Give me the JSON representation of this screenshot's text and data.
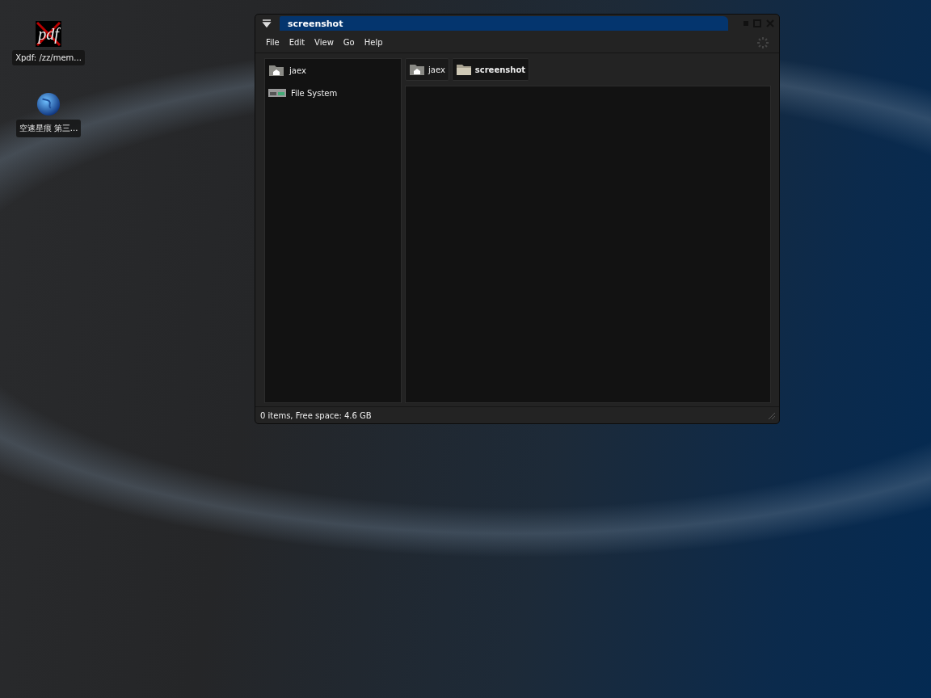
{
  "desktop_icons": [
    {
      "kind": "pdf",
      "icon_text": "pdf",
      "label": "Xpdf: /zz/mem..."
    },
    {
      "kind": "globe",
      "label": "空速星痕 第三..."
    }
  ],
  "window": {
    "title": "screenshot",
    "menu": [
      "File",
      "Edit",
      "View",
      "Go",
      "Help"
    ],
    "sidebar": {
      "items": [
        {
          "kind": "home",
          "label": "jaex",
          "selected": false
        },
        {
          "kind": "drive",
          "label": "File System",
          "selected": false
        }
      ]
    },
    "path_bar": [
      {
        "kind": "home",
        "label": "jaex",
        "selected": false
      },
      {
        "kind": "folder",
        "label": "screenshot",
        "selected": true
      }
    ],
    "status_bar": "0 items, Free space: 4.6 GB"
  }
}
